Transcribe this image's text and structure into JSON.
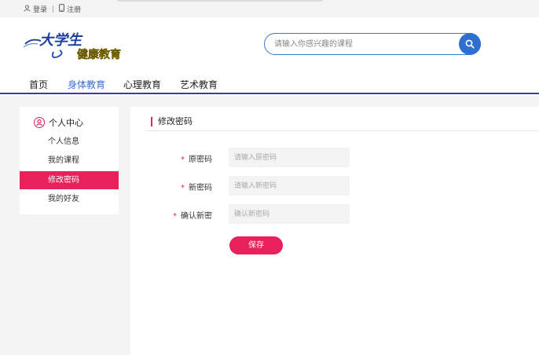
{
  "topbar": {
    "login": "登录",
    "separator": "|",
    "register": "注册"
  },
  "logo": {
    "line1": "大学生",
    "line2": "健康教育"
  },
  "search": {
    "placeholder": "请输入你感兴趣的课程"
  },
  "nav": {
    "items": [
      "首页",
      "身体教育",
      "心理教育",
      "艺术教育"
    ],
    "active": "身体教育"
  },
  "sidebar": {
    "title": "个人中心",
    "items": [
      "个人信息",
      "我的课程",
      "修改密码",
      "我的好友"
    ],
    "active": "修改密码"
  },
  "form": {
    "title": "修改密码",
    "fields": [
      {
        "label": "原密码",
        "placeholder": "请输入原密码"
      },
      {
        "label": "新密码",
        "placeholder": "请输入新密码"
      },
      {
        "label": "确认新密",
        "placeholder": "确认新密码"
      }
    ],
    "required_mark": "*",
    "save_label": "保存"
  },
  "colors": {
    "accent": "#e8215a",
    "brand_blue": "#2e6fd1",
    "nav_underline": "#3a3aa8"
  }
}
